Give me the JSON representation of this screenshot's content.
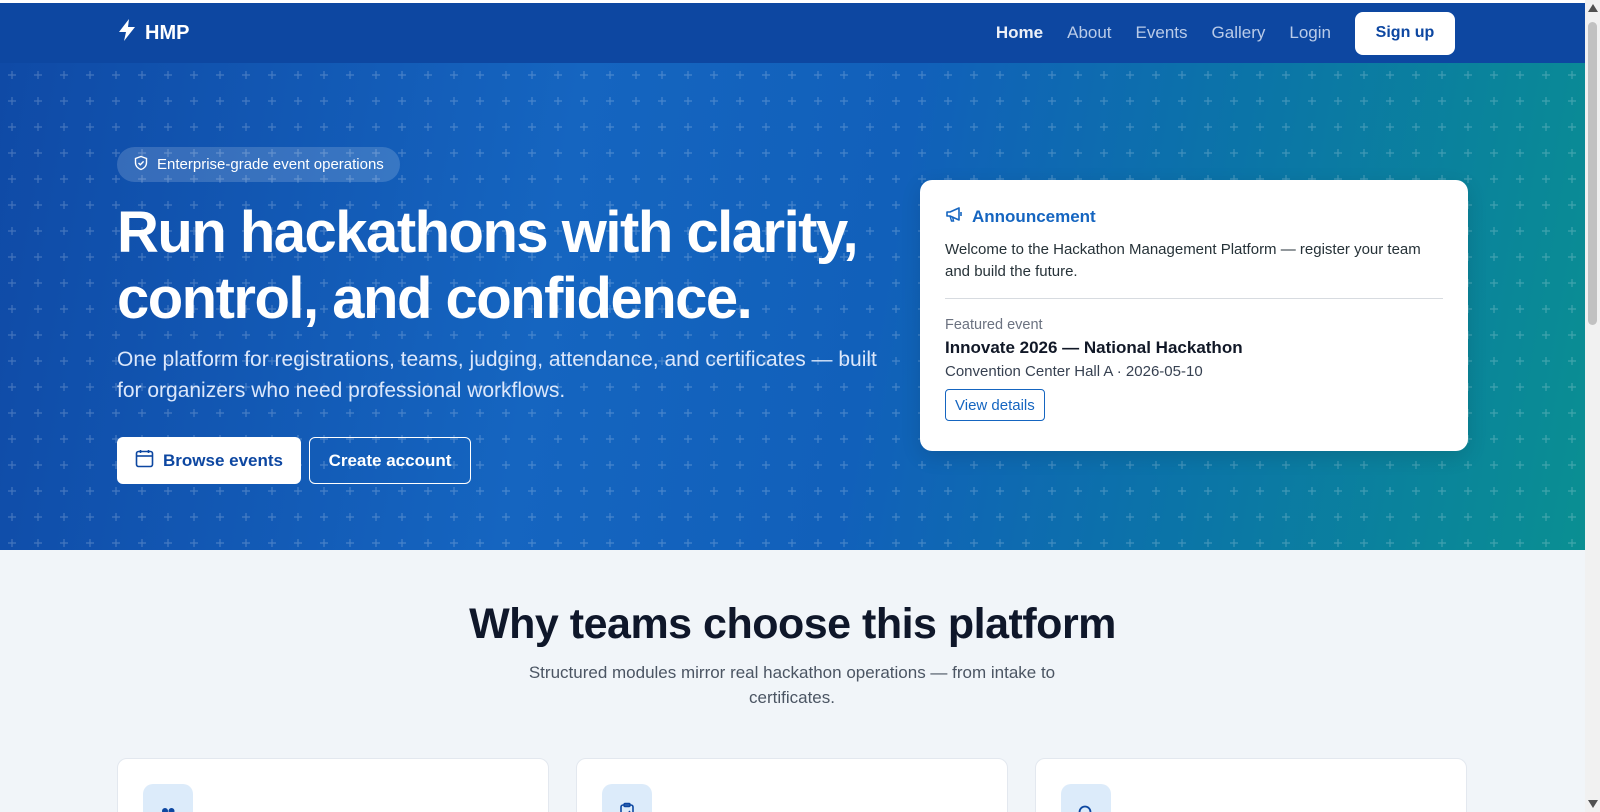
{
  "colors": {
    "nav_bg": "#0d47a1",
    "primary": "#1565c0",
    "hero_gradient_start": "#0f4aa6",
    "hero_gradient_end": "#0a8f92",
    "page_bg": "#f1f5f9"
  },
  "navbar": {
    "brand": "HMP",
    "brand_icon": "bolt-icon",
    "links": [
      {
        "label": "Home",
        "active": true
      },
      {
        "label": "About",
        "active": false
      },
      {
        "label": "Events",
        "active": false
      },
      {
        "label": "Gallery",
        "active": false
      },
      {
        "label": "Login",
        "active": false
      }
    ],
    "signup_label": "Sign up"
  },
  "hero": {
    "badge": "Enterprise-grade event operations",
    "badge_icon": "shield-check-icon",
    "title": "Run hackathons with clarity, control, and confidence.",
    "subtitle": "One platform for registrations, teams, judging, attendance, and certificates — built for organizers who need professional workflows.",
    "primary_button": "Browse events",
    "primary_button_icon": "calendar-icon",
    "secondary_button": "Create account"
  },
  "announcement": {
    "heading": "Announcement",
    "heading_icon": "megaphone-icon",
    "text": "Welcome to the Hackathon Management Platform — register your team and build the future.",
    "featured_label": "Featured event",
    "featured_title": "Innovate 2026 — National Hackathon",
    "featured_meta": "Convention Center Hall A · 2026-05-10",
    "view_button": "View details"
  },
  "why": {
    "title": "Why teams choose this platform",
    "subtitle": "Structured modules mirror real hackathon operations — from intake to certificates.",
    "cards": [
      {
        "icon": "people-icon"
      },
      {
        "icon": "clipboard-icon"
      },
      {
        "icon": "search-icon"
      }
    ]
  }
}
